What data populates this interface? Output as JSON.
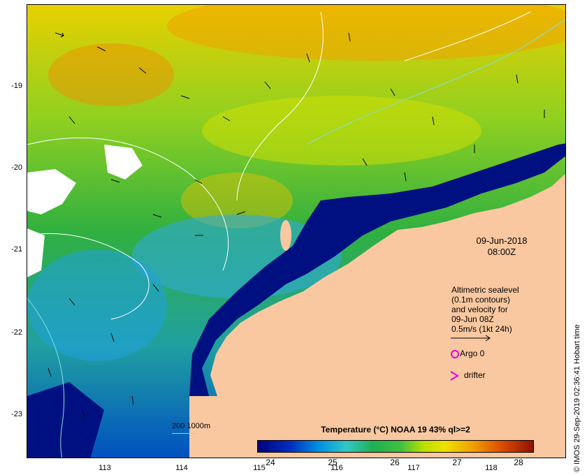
{
  "map": {
    "y_ticks": [
      "-19",
      "-20",
      "-21",
      "-22",
      "-23"
    ],
    "x_ticks": [
      "113",
      "114",
      "115",
      "116",
      "117",
      "118"
    ]
  },
  "date": {
    "day": "09-Jun-2018",
    "time": "08:00Z"
  },
  "legend": {
    "lines": [
      "Altimetric sealevel",
      "(0.1m contours)",
      "and velocity for",
      "09-Jun 08Z",
      "0.5m/s (1kt 24h)"
    ],
    "argo": "Argo 0",
    "drifter": "drifter"
  },
  "depth_legend": "200  1000m",
  "colorbar": {
    "title": "Temperature (°C) NOAA 19 43% ql>=2",
    "ticks": [
      "24",
      "25",
      "26",
      "27",
      "28"
    ]
  },
  "credit": "© IMOS 29-Sep-2019 02:36:41 Hobart time",
  "colors": {
    "land": "#f9c8a0",
    "cloud": "#ffffff",
    "argo": "#e000e0",
    "drifter": "#e000e0"
  }
}
